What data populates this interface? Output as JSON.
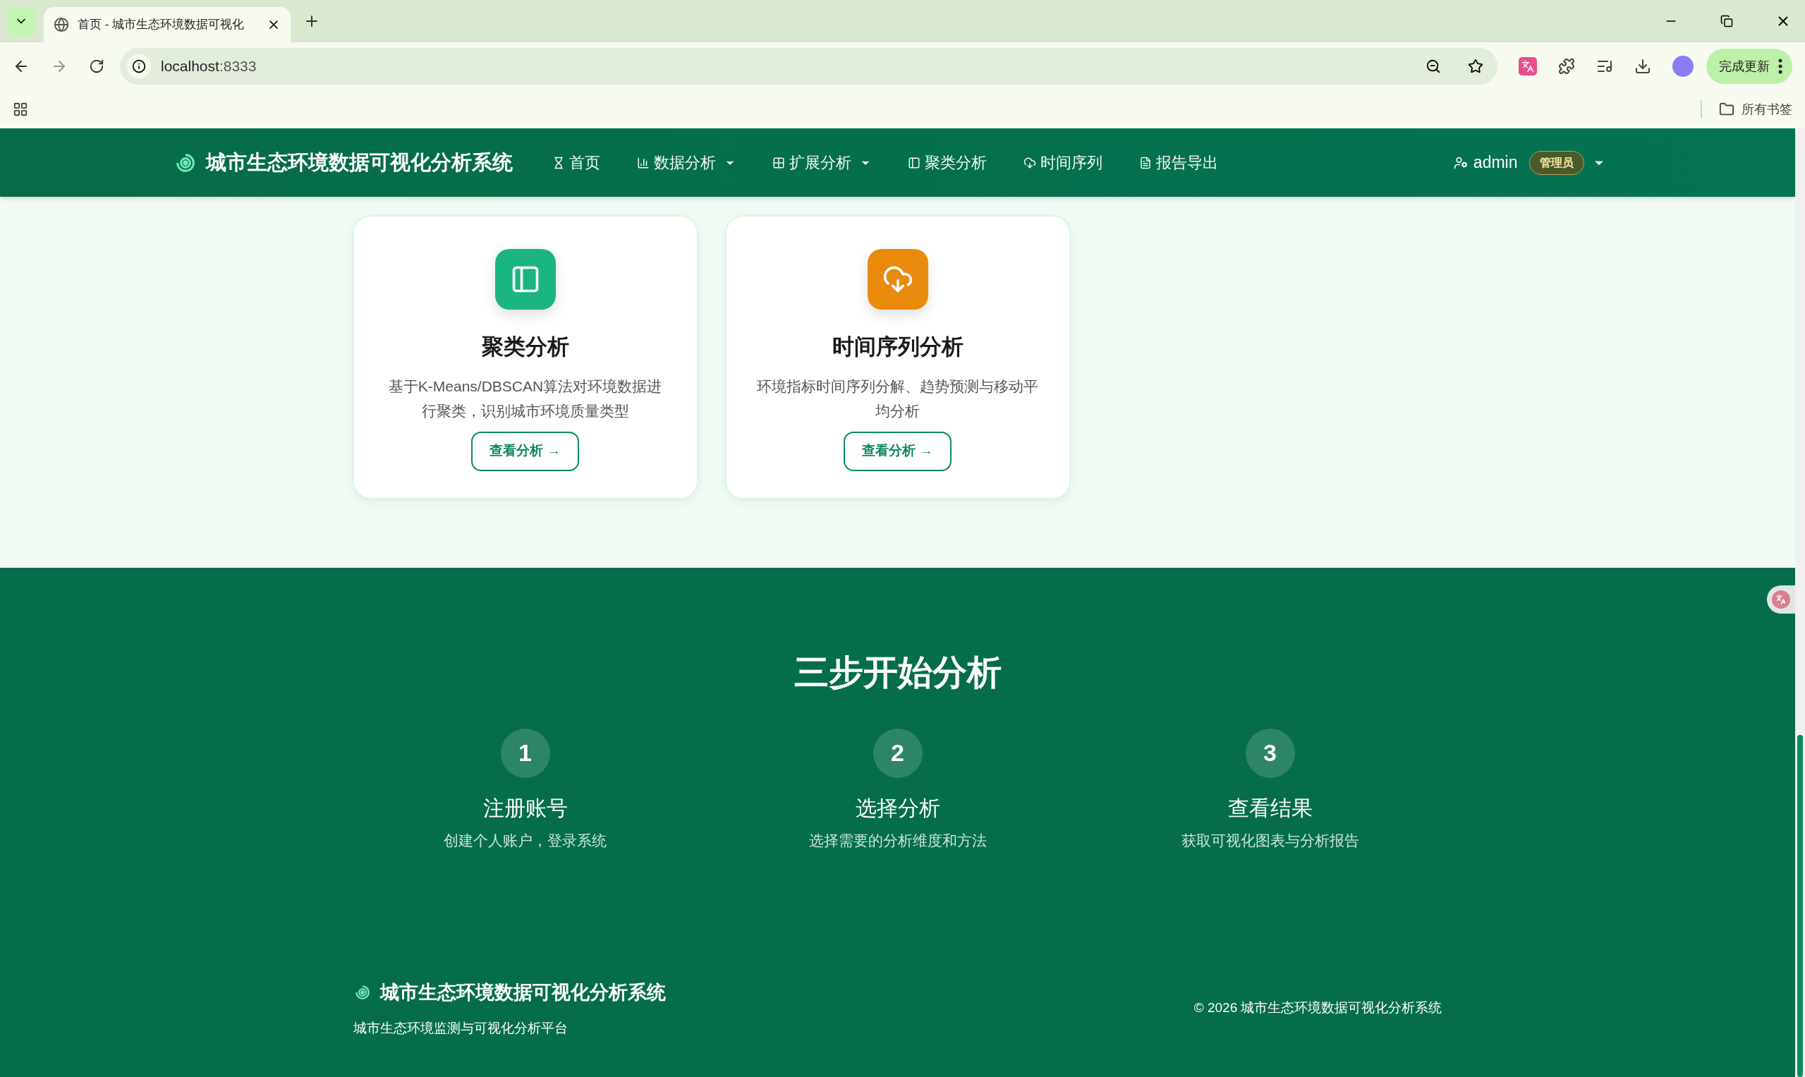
{
  "browser": {
    "tab_title": "首页 - 城市生态环境数据可视化",
    "url_host": "localhost",
    "url_port": ":8333",
    "update_button": "完成更新",
    "bookmarks_label": "所有书签"
  },
  "navbar": {
    "brand": "城市生态环境数据可视化分析系统",
    "links": [
      {
        "label": "首页",
        "kind": "hourglass",
        "dropdown": false
      },
      {
        "label": "数据分析",
        "kind": "bars",
        "dropdown": true
      },
      {
        "label": "扩展分析",
        "kind": "grid",
        "dropdown": true
      },
      {
        "label": "聚类分析",
        "kind": "panel",
        "dropdown": false
      },
      {
        "label": "时间序列",
        "kind": "cloud",
        "dropdown": false
      },
      {
        "label": "报告导出",
        "kind": "report",
        "dropdown": false
      }
    ],
    "user": {
      "name": "admin",
      "role": "管理员"
    }
  },
  "features": [
    {
      "kind": "panel",
      "title": "聚类分析",
      "description": "基于K-Means/DBSCAN算法对环境数据进行聚类，识别城市环境质量类型",
      "button": "查看分析 →",
      "color": "#1bb580"
    },
    {
      "kind": "cloud",
      "title": "时间序列分析",
      "description": "环境指标时间序列分解、趋势预测与移动平均分析",
      "button": "查看分析 →",
      "color": "#ea8a0c"
    }
  ],
  "steps": {
    "title": "三步开始分析",
    "items": [
      {
        "number": "1",
        "title": "注册账号",
        "description": "创建个人账户，登录系统"
      },
      {
        "number": "2",
        "title": "选择分析",
        "description": "选择需要的分析维度和方法"
      },
      {
        "number": "3",
        "title": "查看结果",
        "description": "获取可视化图表与分析报告"
      }
    ]
  },
  "footer": {
    "brand": "城市生态环境数据可视化分析系统",
    "tagline": "城市生态环境监测与可视化分析平台",
    "copyright": "© 2026 城市生态环境数据可视化分析系统"
  }
}
